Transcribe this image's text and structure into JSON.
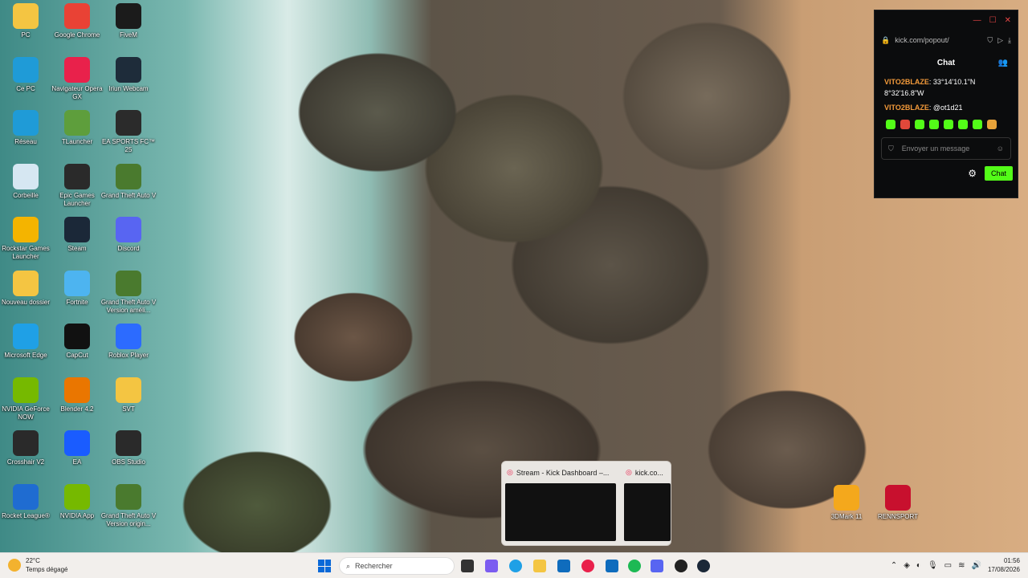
{
  "desktop": {
    "icons": [
      {
        "label": "PC",
        "icon": "folder-icon",
        "color": "#f4c542"
      },
      {
        "label": "Google Chrome",
        "icon": "chrome-icon",
        "color": "#e94235"
      },
      {
        "label": "FiveM",
        "icon": "fivem-icon",
        "color": "#1b1b1b"
      },
      {
        "label": "Ce PC",
        "icon": "monitor-icon",
        "color": "#1f9bd7"
      },
      {
        "label": "Navigateur Opera GX",
        "icon": "opera-gx-icon",
        "color": "#e9214b"
      },
      {
        "label": "Iriun Webcam",
        "icon": "webcam-icon",
        "color": "#1e2c3a"
      },
      {
        "label": "Réseau",
        "icon": "network-icon",
        "color": "#1f9bd7"
      },
      {
        "label": "TLauncher",
        "icon": "minecraft-icon",
        "color": "#5e9e3c"
      },
      {
        "label": "EA SPORTS FC™ 25",
        "icon": "fc25-icon",
        "color": "#2b2b2b"
      },
      {
        "label": "Corbeille",
        "icon": "recycle-bin-icon",
        "color": "#d6e7f2"
      },
      {
        "label": "Epic Games Launcher",
        "icon": "epic-games-icon",
        "color": "#2a2a2a"
      },
      {
        "label": "Grand Theft Auto V",
        "icon": "gta-v-icon",
        "color": "#4a7a2e"
      },
      {
        "label": "Rockstar Games Launcher",
        "icon": "rockstar-icon",
        "color": "#f4b400"
      },
      {
        "label": "Steam",
        "icon": "steam-icon",
        "color": "#1b2838"
      },
      {
        "label": "Discord",
        "icon": "discord-icon",
        "color": "#5865f2"
      },
      {
        "label": "Nouveau dossier",
        "icon": "folder-icon",
        "color": "#f4c542"
      },
      {
        "label": "Fortnite",
        "icon": "fortnite-icon",
        "color": "#4db4f0"
      },
      {
        "label": "Grand Theft Auto V Version améli...",
        "icon": "gta-v-icon",
        "color": "#4a7a2e"
      },
      {
        "label": "Microsoft Edge",
        "icon": "edge-icon",
        "color": "#1fa0e6"
      },
      {
        "label": "CapCut",
        "icon": "capcut-icon",
        "color": "#111111"
      },
      {
        "label": "Roblox Player",
        "icon": "roblox-icon",
        "color": "#2c6bff"
      },
      {
        "label": "NVIDIA GeForce NOW",
        "icon": "geforce-now-icon",
        "color": "#76b900"
      },
      {
        "label": "Blender 4.2",
        "icon": "blender-icon",
        "color": "#ea7600"
      },
      {
        "label": "SVT",
        "icon": "folder-icon",
        "color": "#f4c542"
      },
      {
        "label": "Crosshair V2",
        "icon": "crosshair-icon",
        "color": "#2a2a2a"
      },
      {
        "label": "EA",
        "icon": "ea-icon",
        "color": "#1a5cff"
      },
      {
        "label": "OBS Studio",
        "icon": "obs-icon",
        "color": "#2a2a2a"
      },
      {
        "label": "Rocket League®",
        "icon": "rocket-league-icon",
        "color": "#1f6cd1"
      },
      {
        "label": "NVIDIA App",
        "icon": "nvidia-app-icon",
        "color": "#76b900"
      },
      {
        "label": "Grand Theft Auto V Version origin...",
        "icon": "gta-v-icon",
        "color": "#4a7a2e"
      },
      {
        "label": "3DMark 11",
        "icon": "3dmark-icon",
        "color": "#f4a81c"
      },
      {
        "label": "RENNSPORT",
        "icon": "rennsport-icon",
        "color": "#c8102e"
      }
    ]
  },
  "chat_window": {
    "url": "kick.com/popout/",
    "header": "Chat",
    "messages": [
      {
        "user": "VITO2BLAZE",
        "text": "33°14'10.1\"N 8°32'16.8\"W"
      },
      {
        "user": "VITO2BLAZE",
        "text": "@ot1d21"
      }
    ],
    "input_placeholder": "Envoyer un message",
    "send_label": "Chat",
    "accent": "#53fc18"
  },
  "preview": {
    "items": [
      {
        "title": "Stream - Kick Dashboard –..."
      },
      {
        "title": "kick.co..."
      }
    ]
  },
  "taskbar": {
    "weather_temp": "22°C",
    "weather_desc": "Temps dégagé",
    "search_placeholder": "Rechercher",
    "time": "01:56",
    "date": "17/08/2026"
  }
}
